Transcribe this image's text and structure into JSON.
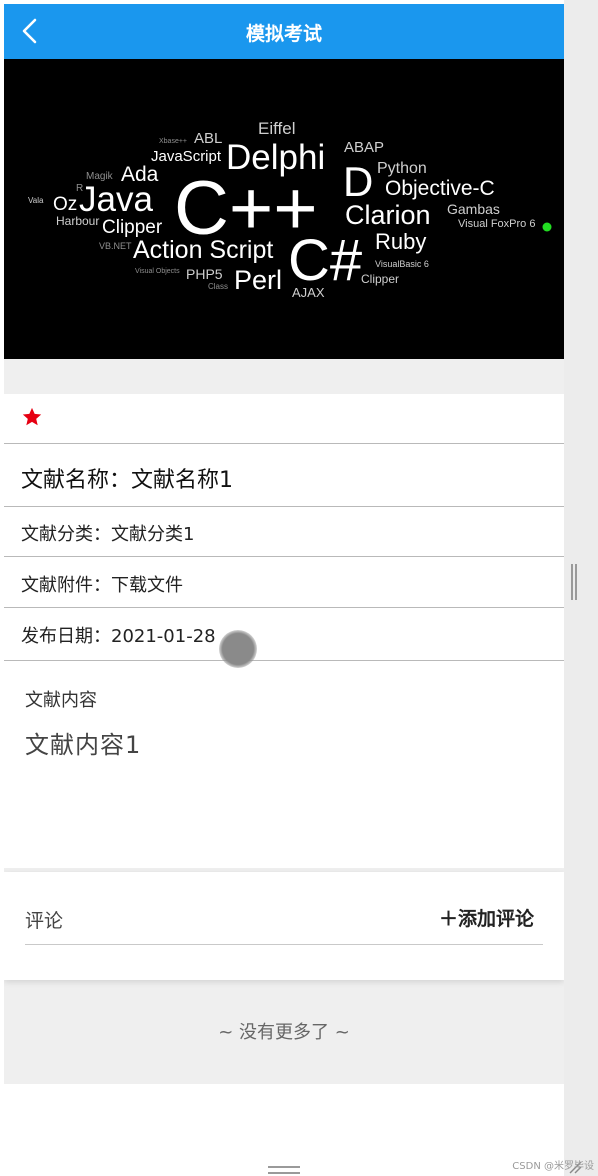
{
  "header": {
    "title": "模拟考试",
    "back_icon": "chevron-left-icon"
  },
  "banner": {
    "words": [
      "ABL",
      "Eiffel",
      "JavaScript",
      "Delphi",
      "ABAP",
      "Python",
      "Magik",
      "Ada",
      "R",
      "C++",
      "D",
      "Objective-C",
      "Vala",
      "Oz",
      "Java",
      "Harbour",
      "Clipper",
      "Clarion",
      "Gambas",
      "Visual FoxPro 6",
      "VB.NET",
      "Action Script",
      "C#",
      "Ruby",
      "Visual Objects",
      "PHP5",
      "Class",
      "Perl",
      "AJAX",
      "VisualBasic 6",
      "Clipper",
      "Xbase++"
    ]
  },
  "detail": {
    "star_icon": "star-icon",
    "star_color": "#e60012",
    "title_row": "文献名称：文献名称1",
    "category_row": "文献分类：文献分类1",
    "attachment_row": "文献附件：下载文件",
    "date_row": "发布日期：2021-01-28",
    "content_label": "文献内容",
    "content_text": "文献内容1"
  },
  "comments": {
    "label": "评论",
    "add_label": "＋添加评论"
  },
  "footer": {
    "no_more": "~ 没有更多了 ~"
  },
  "watermark": "CSDN @米罗毕设",
  "colors": {
    "header_bg": "#1a97ee",
    "page_bg": "#efefef",
    "accent_dot": "#22dd22"
  }
}
